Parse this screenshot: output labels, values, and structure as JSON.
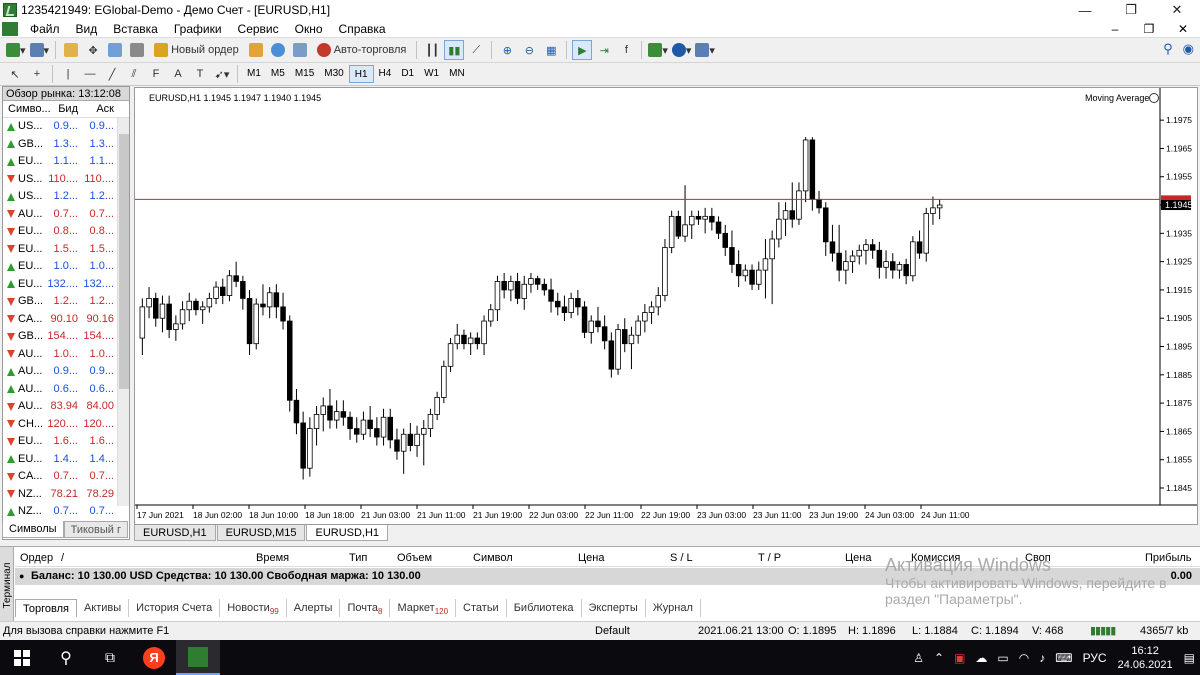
{
  "window": {
    "title": "1235421949: EGlobal-Demo - Демо Счет - [EURUSD,H1]",
    "min": "—",
    "max": "❐",
    "close": "✕"
  },
  "menu": {
    "items": [
      "Файл",
      "Вид",
      "Вставка",
      "Графики",
      "Сервис",
      "Окно",
      "Справка"
    ],
    "right": [
      "–",
      "❐",
      "✕"
    ]
  },
  "toolbar": {
    "new_order": "Новый ордер",
    "autotrade": "Авто-торговля",
    "timeframes": [
      "M1",
      "M5",
      "M15",
      "M30",
      "H1",
      "H4",
      "D1",
      "W1",
      "MN"
    ],
    "selected_tf": "H1"
  },
  "market_watch": {
    "title": "Обзор рынка: 13:12:08",
    "headers": [
      "Симво...",
      "Бид",
      "Аск"
    ],
    "rows": [
      {
        "sym": "US...",
        "bid": "0.9...",
        "ask": "0.9...",
        "dir": "up",
        "color": "blue"
      },
      {
        "sym": "GB...",
        "bid": "1.3...",
        "ask": "1.3...",
        "dir": "up",
        "color": "blue"
      },
      {
        "sym": "EU...",
        "bid": "1.1...",
        "ask": "1.1...",
        "dir": "up",
        "color": "blue"
      },
      {
        "sym": "US...",
        "bid": "110....",
        "ask": "110....",
        "dir": "dn",
        "color": "red"
      },
      {
        "sym": "US...",
        "bid": "1.2...",
        "ask": "1.2...",
        "dir": "up",
        "color": "blue"
      },
      {
        "sym": "AU...",
        "bid": "0.7...",
        "ask": "0.7...",
        "dir": "dn",
        "color": "red"
      },
      {
        "sym": "EU...",
        "bid": "0.8...",
        "ask": "0.8...",
        "dir": "dn",
        "color": "red"
      },
      {
        "sym": "EU...",
        "bid": "1.5...",
        "ask": "1.5...",
        "dir": "dn",
        "color": "red"
      },
      {
        "sym": "EU...",
        "bid": "1.0...",
        "ask": "1.0...",
        "dir": "up",
        "color": "blue"
      },
      {
        "sym": "EU...",
        "bid": "132....",
        "ask": "132....",
        "dir": "up",
        "color": "blue"
      },
      {
        "sym": "GB...",
        "bid": "1.2...",
        "ask": "1.2...",
        "dir": "dn",
        "color": "red"
      },
      {
        "sym": "CA...",
        "bid": "90.10",
        "ask": "90.16",
        "dir": "dn",
        "color": "red"
      },
      {
        "sym": "GB...",
        "bid": "154....",
        "ask": "154....",
        "dir": "dn",
        "color": "red"
      },
      {
        "sym": "AU...",
        "bid": "1.0...",
        "ask": "1.0...",
        "dir": "dn",
        "color": "red"
      },
      {
        "sym": "AU...",
        "bid": "0.9...",
        "ask": "0.9...",
        "dir": "up",
        "color": "blue"
      },
      {
        "sym": "AU...",
        "bid": "0.6...",
        "ask": "0.6...",
        "dir": "up",
        "color": "blue"
      },
      {
        "sym": "AU...",
        "bid": "83.94",
        "ask": "84.00",
        "dir": "dn",
        "color": "red"
      },
      {
        "sym": "CH...",
        "bid": "120....",
        "ask": "120....",
        "dir": "dn",
        "color": "red"
      },
      {
        "sym": "EU...",
        "bid": "1.6...",
        "ask": "1.6...",
        "dir": "dn",
        "color": "red"
      },
      {
        "sym": "EU...",
        "bid": "1.4...",
        "ask": "1.4...",
        "dir": "up",
        "color": "blue"
      },
      {
        "sym": "CA...",
        "bid": "0.7...",
        "ask": "0.7...",
        "dir": "dn",
        "color": "red"
      },
      {
        "sym": "NZ...",
        "bid": "78.21",
        "ask": "78.29",
        "dir": "dn",
        "color": "red"
      },
      {
        "sym": "NZ...",
        "bid": "0.7...",
        "ask": "0.7...",
        "dir": "up",
        "color": "blue"
      }
    ],
    "tabs": [
      "Символы",
      "Тиковый г"
    ]
  },
  "chart": {
    "header": "EURUSD,H1  1.1945 1.1947 1.1940 1.1945",
    "indicator": "Moving Average",
    "price_line": 1.1947,
    "current_price_label": "1.1945",
    "ask_label": "1.1947",
    "tabs": [
      "EURUSD,H1",
      "EURUSD,M15",
      "EURUSD,H1"
    ]
  },
  "chart_data": {
    "type": "candlestick",
    "symbol": "EURUSD,H1",
    "ylim": [
      1.1845,
      1.198
    ],
    "y_ticks": [
      "1.1975",
      "1.1965",
      "1.1955",
      "1.1945",
      "1.1935",
      "1.1925",
      "1.1915",
      "1.1905",
      "1.1895",
      "1.1885",
      "1.1875",
      "1.1865",
      "1.1855",
      "1.1845"
    ],
    "x_ticks": [
      "17 Jun 2021",
      "18 Jun 02:00",
      "18 Jun 10:00",
      "18 Jun 18:00",
      "21 Jun 03:00",
      "21 Jun 11:00",
      "21 Jun 19:00",
      "22 Jun 03:00",
      "22 Jun 11:00",
      "22 Jun 19:00",
      "23 Jun 03:00",
      "23 Jun 11:00",
      "23 Jun 19:00",
      "24 Jun 03:00",
      "24 Jun 11:00"
    ],
    "candles": [
      [
        1.1898,
        1.1912,
        1.1892,
        1.1909
      ],
      [
        1.1909,
        1.1916,
        1.1905,
        1.1912
      ],
      [
        1.1912,
        1.1914,
        1.1902,
        1.1905
      ],
      [
        1.1905,
        1.1913,
        1.19,
        1.191
      ],
      [
        1.191,
        1.1913,
        1.1898,
        1.1901
      ],
      [
        1.1901,
        1.1906,
        1.1897,
        1.1903
      ],
      [
        1.1903,
        1.1911,
        1.1901,
        1.1908
      ],
      [
        1.1908,
        1.1914,
        1.1904,
        1.1911
      ],
      [
        1.1911,
        1.1912,
        1.1906,
        1.1908
      ],
      [
        1.1908,
        1.1911,
        1.1903,
        1.1909
      ],
      [
        1.1909,
        1.1914,
        1.1907,
        1.1912
      ],
      [
        1.1912,
        1.1918,
        1.191,
        1.1916
      ],
      [
        1.1916,
        1.1919,
        1.191,
        1.1913
      ],
      [
        1.1913,
        1.1922,
        1.1911,
        1.192
      ],
      [
        1.192,
        1.1925,
        1.1916,
        1.1918
      ],
      [
        1.1918,
        1.192,
        1.1908,
        1.1912
      ],
      [
        1.1912,
        1.1915,
        1.1892,
        1.1896
      ],
      [
        1.1896,
        1.1912,
        1.1894,
        1.191
      ],
      [
        1.191,
        1.1917,
        1.1906,
        1.1909
      ],
      [
        1.1909,
        1.1916,
        1.1905,
        1.1914
      ],
      [
        1.1914,
        1.1917,
        1.1905,
        1.1909
      ],
      [
        1.1909,
        1.1914,
        1.1901,
        1.1904
      ],
      [
        1.1904,
        1.1906,
        1.1872,
        1.1876
      ],
      [
        1.1876,
        1.188,
        1.1864,
        1.1868
      ],
      [
        1.1868,
        1.1872,
        1.1848,
        1.1852
      ],
      [
        1.1852,
        1.187,
        1.1849,
        1.1866
      ],
      [
        1.1866,
        1.1874,
        1.186,
        1.1871
      ],
      [
        1.1871,
        1.1877,
        1.1865,
        1.1874
      ],
      [
        1.1874,
        1.188,
        1.1866,
        1.1869
      ],
      [
        1.1869,
        1.1876,
        1.1866,
        1.1872
      ],
      [
        1.1872,
        1.1876,
        1.1867,
        1.187
      ],
      [
        1.187,
        1.1872,
        1.1862,
        1.1866
      ],
      [
        1.1866,
        1.187,
        1.1861,
        1.1864
      ],
      [
        1.1864,
        1.1872,
        1.1862,
        1.1869
      ],
      [
        1.1869,
        1.1874,
        1.1863,
        1.1866
      ],
      [
        1.1866,
        1.187,
        1.186,
        1.1863
      ],
      [
        1.1863,
        1.1873,
        1.186,
        1.187
      ],
      [
        1.187,
        1.1873,
        1.1859,
        1.1862
      ],
      [
        1.1862,
        1.1866,
        1.1855,
        1.1858
      ],
      [
        1.1858,
        1.1866,
        1.185,
        1.1864
      ],
      [
        1.1864,
        1.1868,
        1.1858,
        1.186
      ],
      [
        1.186,
        1.1867,
        1.1856,
        1.1864
      ],
      [
        1.1864,
        1.1869,
        1.1853,
        1.1866
      ],
      [
        1.1866,
        1.1873,
        1.1863,
        1.1871
      ],
      [
        1.1871,
        1.1879,
        1.1869,
        1.1877
      ],
      [
        1.1877,
        1.189,
        1.1875,
        1.1888
      ],
      [
        1.1888,
        1.1898,
        1.1886,
        1.1896
      ],
      [
        1.1896,
        1.1903,
        1.1894,
        1.1899
      ],
      [
        1.1899,
        1.1901,
        1.1894,
        1.1896
      ],
      [
        1.1896,
        1.19,
        1.1892,
        1.1898
      ],
      [
        1.1898,
        1.19,
        1.1894,
        1.1896
      ],
      [
        1.1896,
        1.1906,
        1.1892,
        1.1904
      ],
      [
        1.1904,
        1.191,
        1.1902,
        1.1908
      ],
      [
        1.1908,
        1.192,
        1.1904,
        1.1918
      ],
      [
        1.1918,
        1.1921,
        1.1912,
        1.1915
      ],
      [
        1.1915,
        1.192,
        1.1911,
        1.1918
      ],
      [
        1.1918,
        1.1921,
        1.191,
        1.1912
      ],
      [
        1.1912,
        1.192,
        1.1908,
        1.1917
      ],
      [
        1.1917,
        1.1921,
        1.1914,
        1.1919
      ],
      [
        1.1919,
        1.192,
        1.1915,
        1.1917
      ],
      [
        1.1917,
        1.1919,
        1.1913,
        1.1915
      ],
      [
        1.1915,
        1.1919,
        1.1907,
        1.1911
      ],
      [
        1.1911,
        1.1914,
        1.1906,
        1.1909
      ],
      [
        1.1909,
        1.1913,
        1.1904,
        1.1907
      ],
      [
        1.1907,
        1.1914,
        1.1905,
        1.1912
      ],
      [
        1.1912,
        1.1915,
        1.1906,
        1.1909
      ],
      [
        1.1909,
        1.1911,
        1.1898,
        1.19
      ],
      [
        1.19,
        1.1906,
        1.1896,
        1.1904
      ],
      [
        1.1904,
        1.1909,
        1.19,
        1.1902
      ],
      [
        1.1902,
        1.1906,
        1.1894,
        1.1897
      ],
      [
        1.1897,
        1.19,
        1.1884,
        1.1887
      ],
      [
        1.1887,
        1.1903,
        1.1885,
        1.1901
      ],
      [
        1.1901,
        1.1905,
        1.1893,
        1.1896
      ],
      [
        1.1896,
        1.1902,
        1.1887,
        1.1899
      ],
      [
        1.1899,
        1.1906,
        1.1896,
        1.1904
      ],
      [
        1.1904,
        1.191,
        1.19,
        1.1907
      ],
      [
        1.1907,
        1.1911,
        1.1903,
        1.1909
      ],
      [
        1.1909,
        1.1916,
        1.1906,
        1.1913
      ],
      [
        1.1913,
        1.1933,
        1.1911,
        1.193
      ],
      [
        1.193,
        1.1943,
        1.1928,
        1.1941
      ],
      [
        1.1941,
        1.1943,
        1.1933,
        1.1934
      ],
      [
        1.1934,
        1.1952,
        1.1932,
        1.1938
      ],
      [
        1.1938,
        1.1943,
        1.1933,
        1.1941
      ],
      [
        1.1941,
        1.1943,
        1.1938,
        1.194
      ],
      [
        1.194,
        1.1944,
        1.1935,
        1.1941
      ],
      [
        1.1941,
        1.1944,
        1.1936,
        1.1939
      ],
      [
        1.1939,
        1.1941,
        1.1933,
        1.1935
      ],
      [
        1.1935,
        1.1938,
        1.1927,
        1.193
      ],
      [
        1.193,
        1.1936,
        1.1921,
        1.1924
      ],
      [
        1.1924,
        1.1929,
        1.1916,
        1.192
      ],
      [
        1.192,
        1.1924,
        1.1918,
        1.1922
      ],
      [
        1.1922,
        1.1924,
        1.1915,
        1.1917
      ],
      [
        1.1917,
        1.1925,
        1.1915,
        1.1922
      ],
      [
        1.1922,
        1.1933,
        1.1912,
        1.1926
      ],
      [
        1.1926,
        1.1936,
        1.191,
        1.1933
      ],
      [
        1.1933,
        1.1946,
        1.193,
        1.194
      ],
      [
        1.194,
        1.1946,
        1.1934,
        1.1943
      ],
      [
        1.1943,
        1.1953,
        1.1937,
        1.194
      ],
      [
        1.194,
        1.1953,
        1.1938,
        1.195
      ],
      [
        1.195,
        1.1969,
        1.1946,
        1.1968
      ],
      [
        1.1968,
        1.1969,
        1.1943,
        1.1947
      ],
      [
        1.1947,
        1.195,
        1.1942,
        1.1944
      ],
      [
        1.1944,
        1.1946,
        1.1927,
        1.1932
      ],
      [
        1.1932,
        1.1938,
        1.1925,
        1.1928
      ],
      [
        1.1928,
        1.1938,
        1.1918,
        1.1922
      ],
      [
        1.1922,
        1.1929,
        1.1917,
        1.1925
      ],
      [
        1.1925,
        1.1929,
        1.1921,
        1.1927
      ],
      [
        1.1927,
        1.1931,
        1.1924,
        1.1929
      ],
      [
        1.1929,
        1.1933,
        1.1924,
        1.1931
      ],
      [
        1.1931,
        1.1933,
        1.1926,
        1.1929
      ],
      [
        1.1929,
        1.1932,
        1.1919,
        1.1923
      ],
      [
        1.1923,
        1.1929,
        1.1919,
        1.1925
      ],
      [
        1.1925,
        1.1928,
        1.1919,
        1.1922
      ],
      [
        1.1922,
        1.1925,
        1.1919,
        1.1924
      ],
      [
        1.1924,
        1.1926,
        1.1917,
        1.192
      ],
      [
        1.192,
        1.1934,
        1.1918,
        1.1932
      ],
      [
        1.1932,
        1.1936,
        1.1926,
        1.1928
      ],
      [
        1.1928,
        1.1944,
        1.1925,
        1.1942
      ],
      [
        1.1942,
        1.1948,
        1.1938,
        1.1944
      ],
      [
        1.1944,
        1.1947,
        1.194,
        1.1945
      ]
    ]
  },
  "terminal": {
    "side_label": "Терминал",
    "headers": [
      "Ордер",
      "/",
      "Время",
      "Тип",
      "Объем",
      "Символ",
      "Цена",
      "S / L",
      "T / P",
      "Цена",
      "Комиссия",
      "Своп",
      "Прибыль"
    ],
    "balance_text": "Баланс: 10 130.00 USD  Средства: 10 130.00  Свободная маржа: 10 130.00",
    "profit_total": "0.00",
    "tabs": [
      {
        "label": "Торговля",
        "badge": ""
      },
      {
        "label": "Активы",
        "badge": ""
      },
      {
        "label": "История Счета",
        "badge": ""
      },
      {
        "label": "Новости",
        "badge": "99"
      },
      {
        "label": "Алерты",
        "badge": ""
      },
      {
        "label": "Почта",
        "badge": "8"
      },
      {
        "label": "Маркет",
        "badge": "120"
      },
      {
        "label": "Статьи",
        "badge": ""
      },
      {
        "label": "Библиотека",
        "badge": ""
      },
      {
        "label": "Эксперты",
        "badge": ""
      },
      {
        "label": "Журнал",
        "badge": ""
      }
    ]
  },
  "watermark": {
    "line1": "Активация Windows",
    "line2": "Чтобы активировать Windows, перейдите в",
    "line3": "раздел \"Параметры\"."
  },
  "status": {
    "help": "Для вызова справки нажмите F1",
    "profile": "Default",
    "datetime": "2021.06.21 13:00",
    "open": "O: 1.1895",
    "high": "H: 1.1896",
    "low": "L: 1.1884",
    "close": "C: 1.1894",
    "volume": "V: 468",
    "traffic": "4365/7 kb"
  },
  "taskbar": {
    "lang": "РУС",
    "time": "16:12",
    "date": "24.06.2021",
    "yandex": "Я"
  }
}
